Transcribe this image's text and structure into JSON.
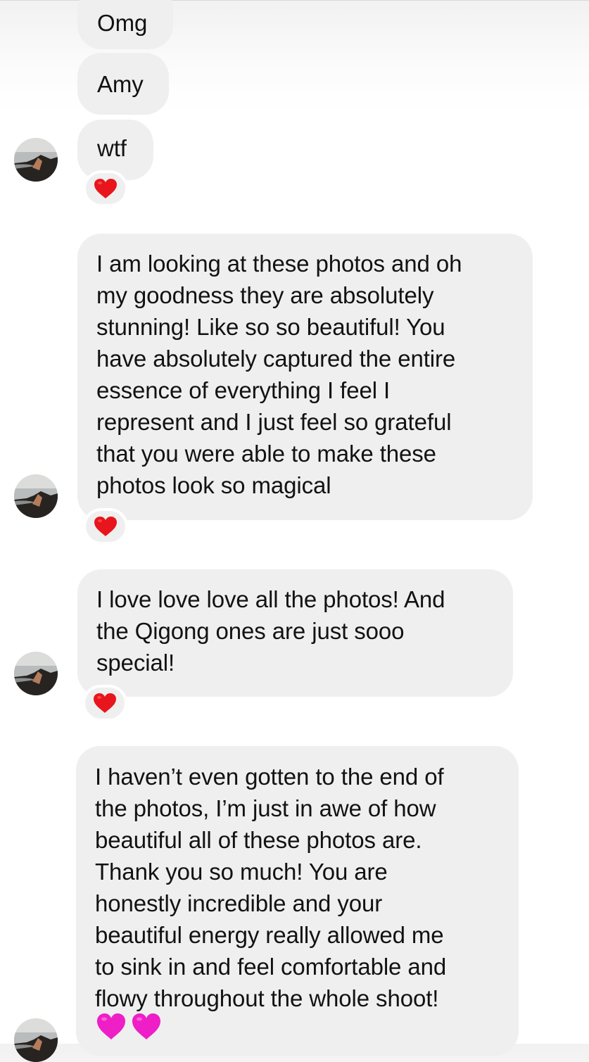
{
  "conversation": {
    "messages": [
      {
        "text": "Omg"
      },
      {
        "text": "Amy"
      },
      {
        "text": "wtf",
        "reaction": "red-heart"
      },
      {
        "lines": [
          "I am looking at these photos and oh",
          "my goodness they are absolutely",
          "stunning! Like so so beautiful! You",
          "have absolutely captured the entire",
          "essence of everything I feel I",
          "represent and I just feel so grateful",
          "that you were able to make these",
          "photos look so magical"
        ],
        "reaction": "red-heart"
      },
      {
        "lines": [
          "I love love love all the photos! And",
          "the Qigong ones are just sooo",
          "special!"
        ],
        "reaction": "red-heart"
      },
      {
        "lines": [
          "I haven’t even gotten to the end of",
          "the photos, I’m just in awe of how",
          "beautiful all of these photos are.",
          "Thank you so much! You are",
          "honestly incredible and your",
          "beautiful energy really allowed me",
          "to sink in and feel comfortable and",
          "flowy throughout the whole shoot!"
        ],
        "emoji": [
          "pink-heart",
          "pink-heart"
        ]
      }
    ]
  },
  "colors": {
    "bubble": "#efefef",
    "text": "#121212",
    "red_heart": "#e8151d",
    "pink_heart": "#ee1fc7",
    "background": "#ffffff"
  }
}
